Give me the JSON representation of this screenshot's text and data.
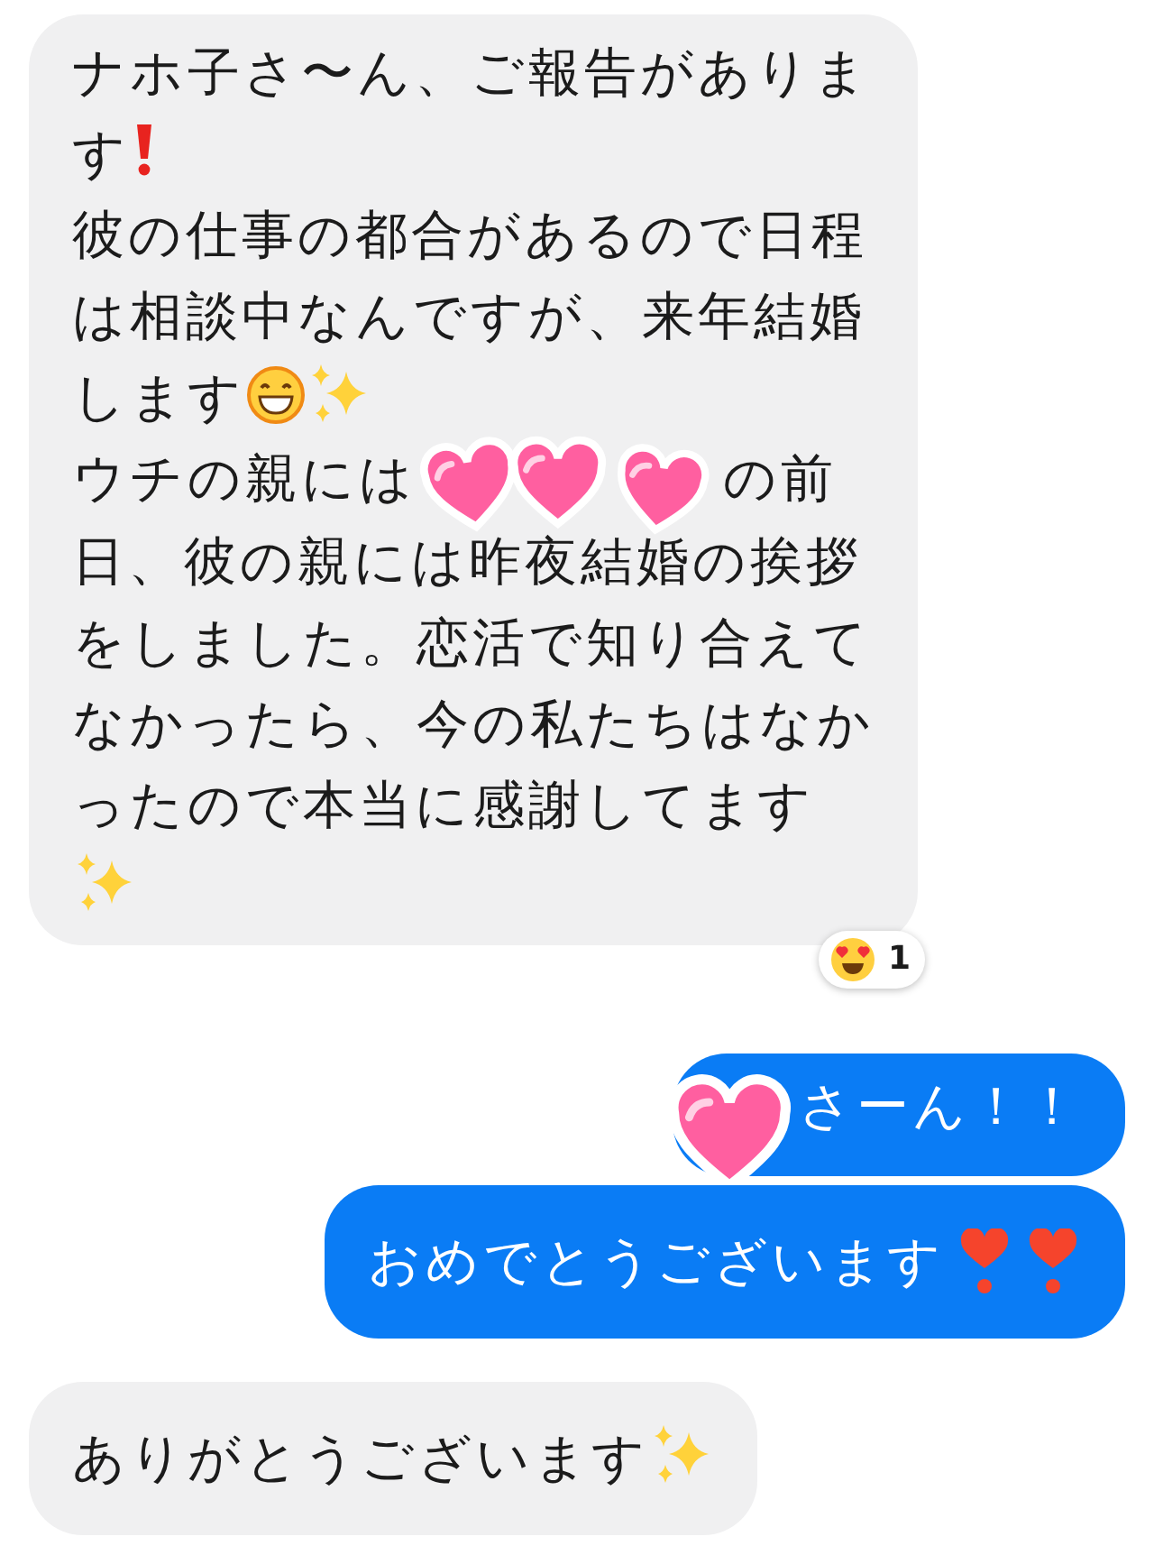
{
  "messages": [
    {
      "kind": "received",
      "lines": [
        [
          {
            "kind": "text",
            "text": "ナホ子さ〜ん、ご報告がありま"
          }
        ],
        [
          {
            "kind": "text",
            "text": "す"
          },
          {
            "kind": "exclamation"
          }
        ],
        [
          {
            "kind": "text",
            "text": "彼の仕事の都合があるので日程"
          }
        ],
        [
          {
            "kind": "text",
            "text": "は相談中なんですが、来年結婚"
          }
        ],
        [
          {
            "kind": "text",
            "text": "します"
          },
          {
            "kind": "grin"
          },
          {
            "kind": "sparkles"
          }
        ],
        [
          {
            "kind": "text",
            "text": "ウチの親には"
          },
          {
            "kind": "hearts"
          },
          {
            "kind": "text",
            "text": "の前"
          }
        ],
        [
          {
            "kind": "text",
            "text": "日、彼の親には昨夜結婚の挨拶"
          }
        ],
        [
          {
            "kind": "text",
            "text": "をしました。恋活で知り合えて"
          }
        ],
        [
          {
            "kind": "text",
            "text": "なかったら、今の私たちはなか"
          }
        ],
        [
          {
            "kind": "text",
            "text": "ったので本当に感謝してます"
          }
        ],
        [
          {
            "kind": "sparkles"
          }
        ]
      ],
      "reaction": {
        "kind": "heart-eyes",
        "count": "1"
      }
    },
    {
      "kind": "sent",
      "lines": [
        [
          {
            "kind": "heart"
          },
          {
            "kind": "text",
            "text": "さーん！！"
          }
        ]
      ]
    },
    {
      "kind": "sent",
      "lines": [
        [
          {
            "kind": "text",
            "text": "おめでとうございます"
          },
          {
            "kind": "heart-exclamation"
          },
          {
            "kind": "heart-exclamation"
          }
        ]
      ]
    },
    {
      "kind": "received",
      "lines": [
        [
          {
            "kind": "text",
            "text": "ありがとうございます"
          },
          {
            "kind": "sparkles"
          }
        ]
      ]
    }
  ]
}
